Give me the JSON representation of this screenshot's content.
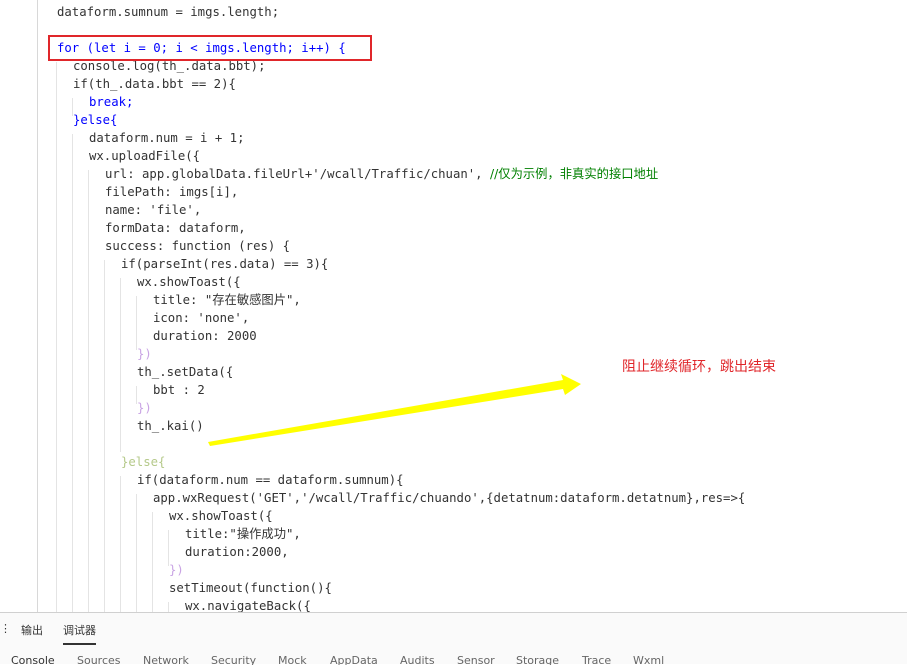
{
  "code": {
    "line_top": "dataform.sumnum = imgs.length;",
    "for_line": "for (let i = 0; i < imgs.length; i++) {",
    "console_line": "console.log(th_.data.bbt);",
    "if_line": "if(th_.data.bbt == 2){",
    "break_line": "break;",
    "else_line": "}else{",
    "num_line": "dataform.num = i + 1;",
    "upload_line": "wx.uploadFile({",
    "url_line_code": "url: app.globalData.fileUrl+'/wcall/Traffic/chuan', ",
    "url_line_comment": "//仅为示例，非真实的接口地址",
    "filepath_line": "filePath: imgs[i],",
    "name_line": "name: 'file',",
    "formdata_line": "formData: dataform,",
    "success_line": "success: function (res) {",
    "parse_line": "if(parseInt(res.data) == 3){",
    "toast_line": "wx.showToast({",
    "title_line": "title: \"存在敏感图片\",",
    "icon_line": "icon: 'none',",
    "duration_line": "duration: 2000",
    "close_paren_line": "})",
    "setdata_line": "th_.setData({",
    "bbt_line": "bbt : 2",
    "close_paren_line2": "})",
    "kai_line": "th_.kai()",
    "else2_line": "}else{",
    "if2_line": "if(dataform.num == dataform.sumnum){",
    "request_line": "app.wxRequest('GET','/wcall/Traffic/chuando',{detatnum:dataform.detatnum},res=>{",
    "toast2_line": "wx.showToast({",
    "title2_line": "title:\"操作成功\",",
    "duration2_line": "duration:2000,",
    "close_paren_line3": "})",
    "settimeout_line": "setTimeout(function(){",
    "navback_line": "wx.navigateBack({"
  },
  "annotation": {
    "text": "阻止继续循环，跳出结束",
    "color": "#e0262a"
  },
  "panel": {
    "tabs": [
      "输出",
      "调试器"
    ],
    "active_tab": "调试器",
    "subtabs": [
      "Console",
      "Sources",
      "Network",
      "Security",
      "Mock",
      "AppData",
      "Audits",
      "Sensor",
      "Storage",
      "Trace",
      "Wxml"
    ],
    "active_subtab": "Console"
  },
  "colors": {
    "highlight_box": "#e0262a",
    "arrow": "#ffff00",
    "keyword": "#0000ff",
    "string": "#a31515",
    "number": "#098658",
    "comment": "#008000"
  }
}
